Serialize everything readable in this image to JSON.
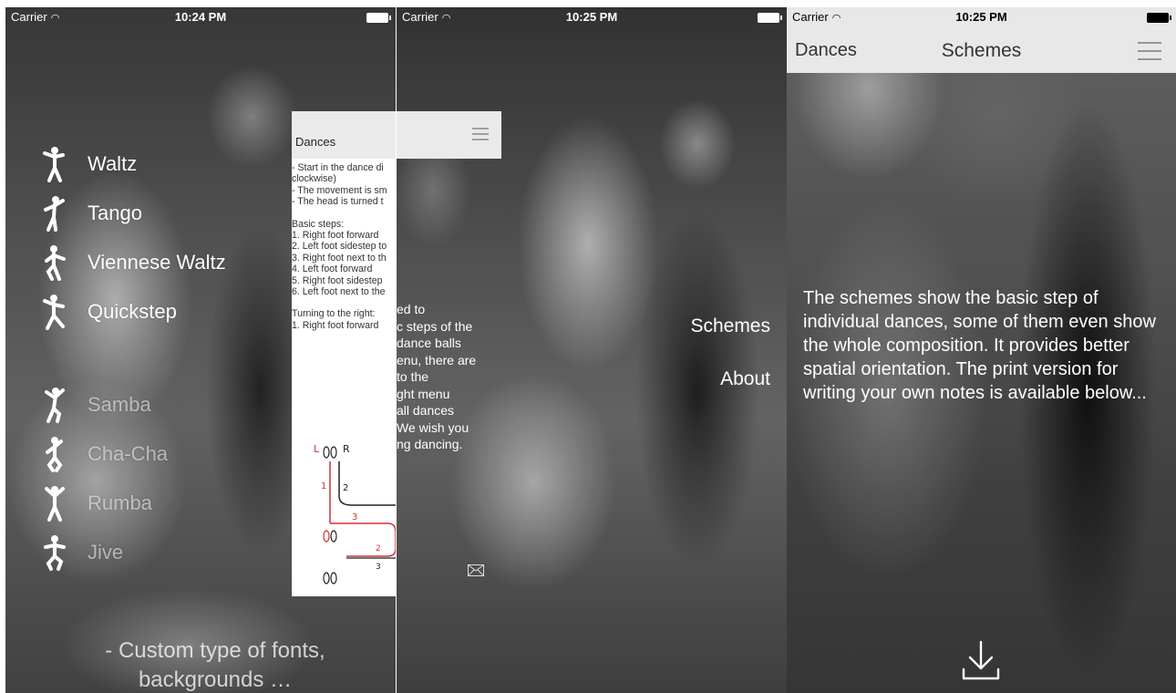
{
  "screens": [
    {
      "status": {
        "carrier": "Carrier",
        "time": "10:24 PM"
      },
      "menu": {
        "standard": [
          {
            "label": "Waltz",
            "icon": "waltz-dancer-icon"
          },
          {
            "label": "Tango",
            "icon": "tango-dancer-icon"
          },
          {
            "label": "Viennese Waltz",
            "icon": "viennese-waltz-dancer-icon"
          },
          {
            "label": "Quickstep",
            "icon": "quickstep-dancer-icon"
          }
        ],
        "latin": [
          {
            "label": "Samba",
            "icon": "samba-dancer-icon"
          },
          {
            "label": "Cha-Cha",
            "icon": "cha-cha-dancer-icon"
          },
          {
            "label": "Rumba",
            "icon": "rumba-dancer-icon"
          },
          {
            "label": "Jive",
            "icon": "jive-dancer-icon"
          }
        ]
      },
      "preview": {
        "nav_title": "Dances",
        "lines": [
          "- Start in the dance di",
          "clockwise)",
          "- The movement is sm",
          "- The head is turned t",
          "",
          "Basic steps:",
          "1. Right foot forward",
          "2. Left foot sidestep to",
          "3. Right foot next to th",
          "4. Left foot forward",
          "5. Right foot sidestep",
          "6. Left foot next to the",
          "",
          "Turning to the right:",
          "1. Right foot forward"
        ]
      },
      "footer_note": [
        "- Custom type of fonts,",
        "backgrounds …"
      ]
    },
    {
      "status": {
        "carrier": "Carrier",
        "time": "10:25 PM"
      },
      "intro_lines": [
        "ed to",
        "c steps of the",
        " dance balls",
        "enu, there are",
        " to the",
        "ght menu",
        "all dances",
        " We wish you",
        "ng dancing."
      ],
      "menu": {
        "schemes": "Schemes",
        "about": "About"
      }
    },
    {
      "status": {
        "carrier": "Carrier",
        "time": "10:25 PM"
      },
      "nav": {
        "back": "Dances",
        "title": "Schemes"
      },
      "description": "The schemes show the basic step of individual dances, some of them even show the whole composition. It provides better spatial orientation. The print version for writing your own notes is available below..."
    }
  ]
}
